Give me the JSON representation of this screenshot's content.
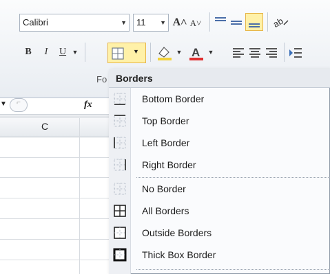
{
  "ribbon": {
    "font_name": "Calibri",
    "font_size": "11",
    "grow_font": "A˄",
    "shrink_font": "A˅",
    "bold": "B",
    "italic": "I",
    "underline": "U",
    "group_label": "Fo"
  },
  "formula": {
    "fx": "fx"
  },
  "sheet": {
    "column_label": "C"
  },
  "menu": {
    "title": "Borders",
    "items": [
      {
        "label": "Bottom Border",
        "icon": "bottom-border-icon"
      },
      {
        "label": "Top Border",
        "icon": "top-border-icon"
      },
      {
        "label": "Left Border",
        "icon": "left-border-icon"
      },
      {
        "label": "Right Border",
        "icon": "right-border-icon"
      },
      {
        "label": "No Border",
        "icon": "no-border-icon"
      },
      {
        "label": "All Borders",
        "icon": "all-borders-icon"
      },
      {
        "label": "Outside Borders",
        "icon": "outside-borders-icon"
      },
      {
        "label": "Thick Box Border",
        "icon": "thick-box-border-icon"
      }
    ]
  },
  "colors": {
    "highlight": "#fff1a8",
    "highlight_border": "#e7b64a",
    "font_color_bar": "#e03030",
    "fill_color_bar": "#f2d23c"
  }
}
